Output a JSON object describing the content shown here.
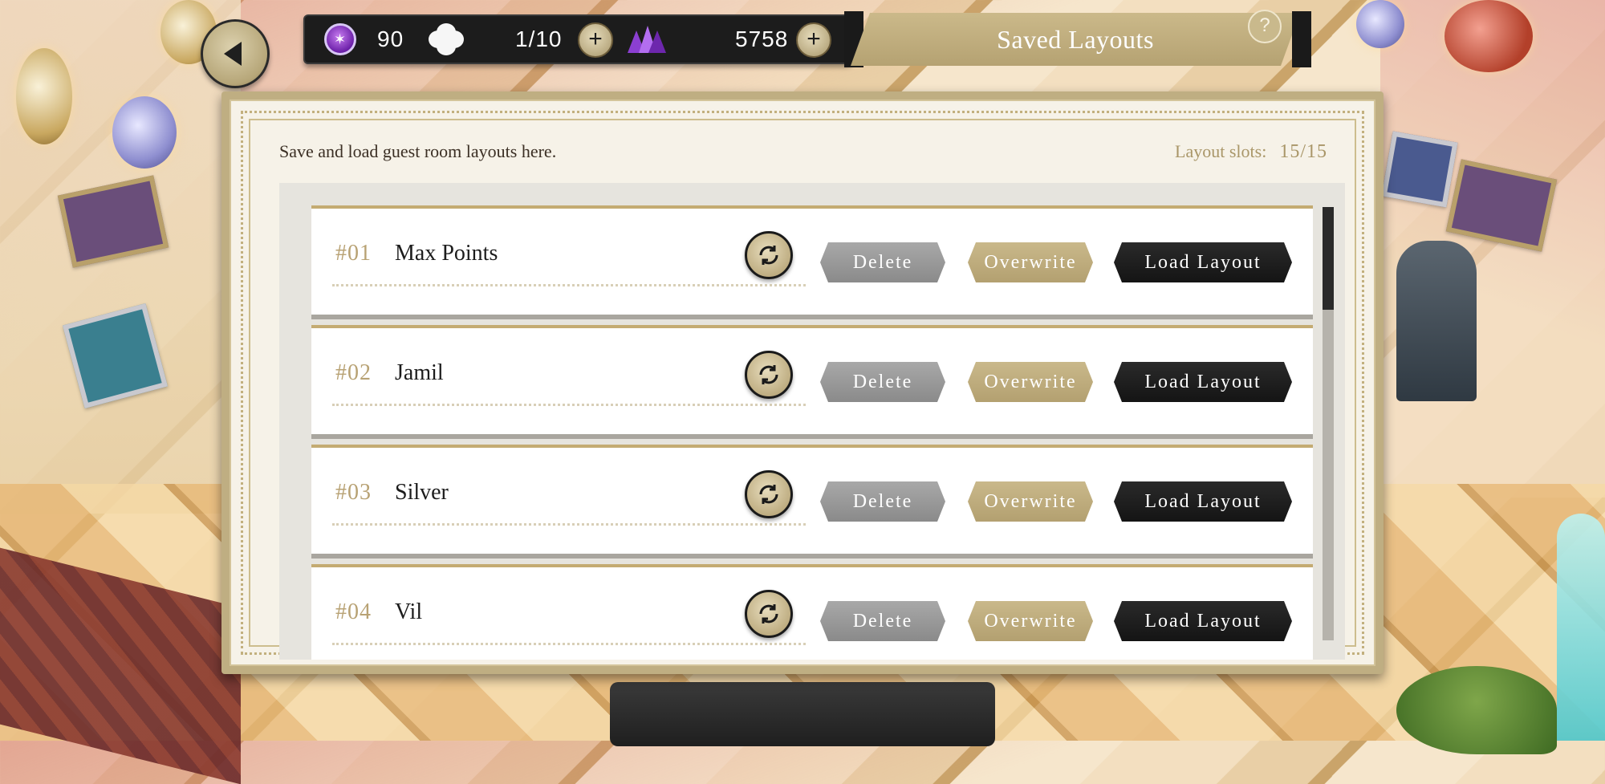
{
  "resources": {
    "gems": "90",
    "flowers": "1/10",
    "crystals": "5758"
  },
  "header": {
    "title": "Saved Layouts",
    "help": "?"
  },
  "panel": {
    "subtitle": "Save and load guest room layouts here.",
    "slots_label": "Layout slots:",
    "slots_value": "15/15"
  },
  "layouts": [
    {
      "num": "#01",
      "name": "Max Points",
      "delete": "Delete",
      "overwrite": "Overwrite",
      "load": "Load Layout"
    },
    {
      "num": "#02",
      "name": "Jamil",
      "delete": "Delete",
      "overwrite": "Overwrite",
      "load": "Load Layout"
    },
    {
      "num": "#03",
      "name": "Silver",
      "delete": "Delete",
      "overwrite": "Overwrite",
      "load": "Load Layout"
    },
    {
      "num": "#04",
      "name": "Vil",
      "delete": "Delete",
      "overwrite": "Overwrite",
      "load": "Load Layout"
    }
  ]
}
